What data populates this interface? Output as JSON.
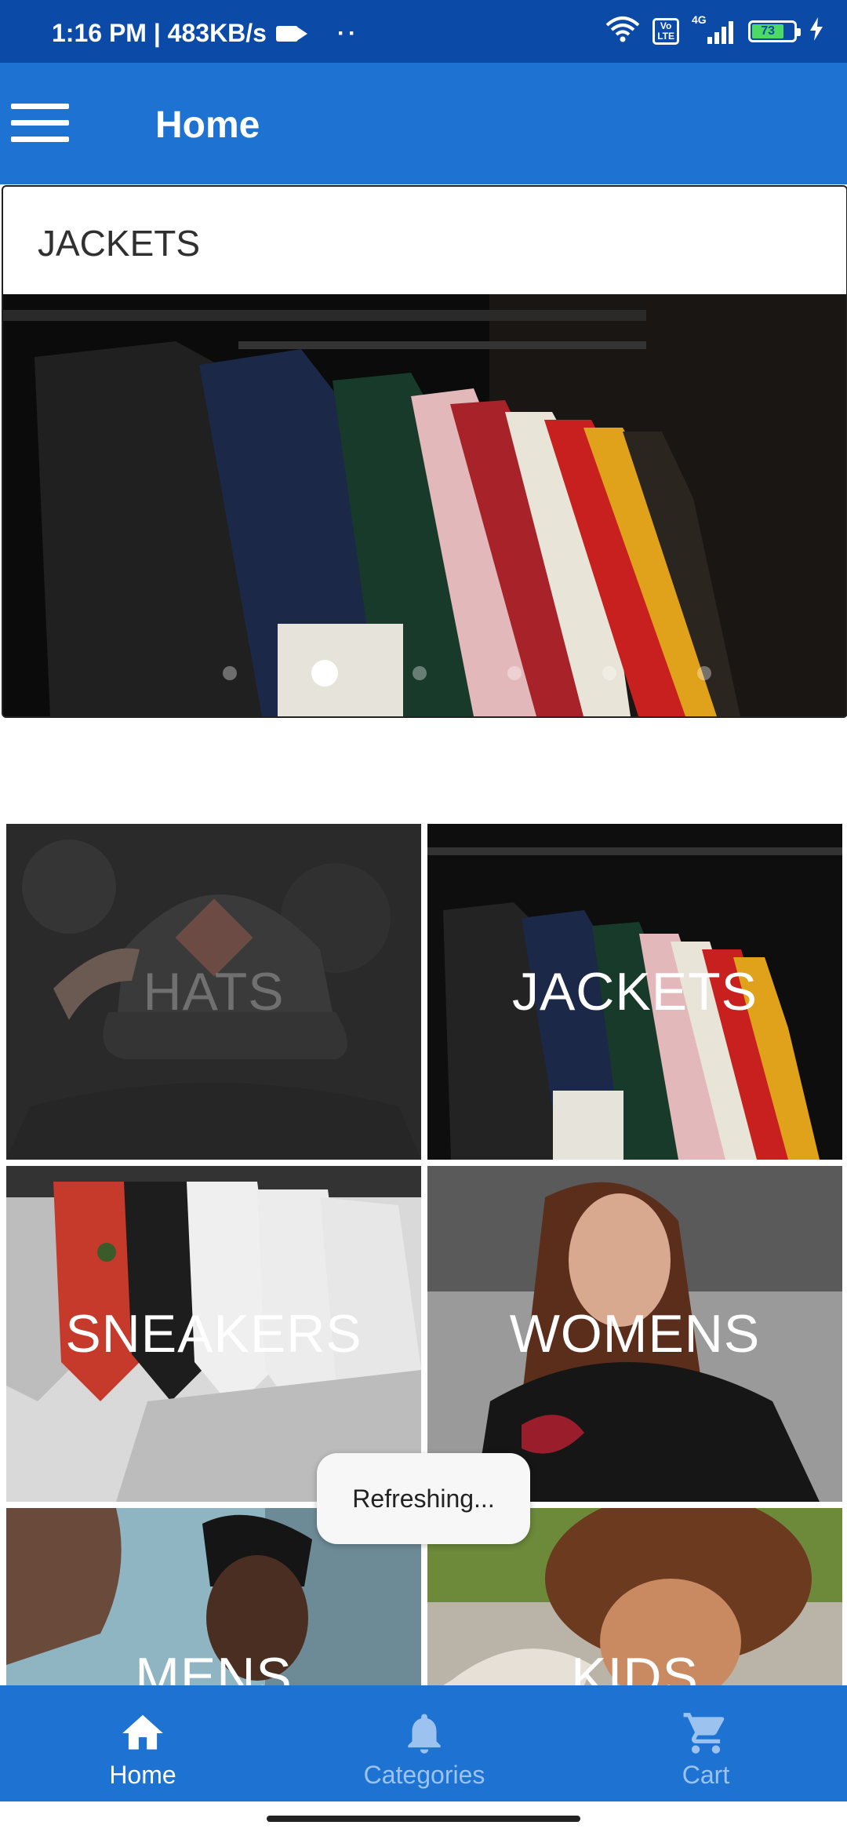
{
  "status_bar": {
    "time_speed": "1:16 PM | 483KB/s",
    "dots": "··",
    "network": "4G",
    "volte": "Vo\nLTE",
    "battery": "73"
  },
  "app_bar": {
    "title": "Home"
  },
  "featured": {
    "title": "JACKETS",
    "dots_count": 6,
    "active_dot": 1
  },
  "categories": [
    {
      "label": "HATS"
    },
    {
      "label": "JACKETS"
    },
    {
      "label": "SNEAKERS"
    },
    {
      "label": "WOMENS"
    },
    {
      "label": "MENS"
    },
    {
      "label": "KIDS"
    }
  ],
  "toast": {
    "text": "Refreshing..."
  },
  "bottom_nav": {
    "items": [
      {
        "label": "Home",
        "icon": "home-icon",
        "active": true
      },
      {
        "label": "Categories",
        "icon": "bell-icon",
        "active": false
      },
      {
        "label": "Cart",
        "icon": "cart-icon",
        "active": false
      }
    ]
  },
  "colors": {
    "status_bar": "#0b4aa6",
    "primary": "#1e73d2",
    "inactive_nav": "#9cc3f0"
  }
}
